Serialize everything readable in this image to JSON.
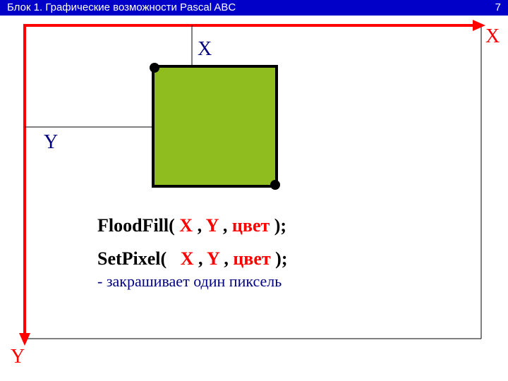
{
  "header": {
    "title": "Блок 1.  Графические возможности Pascal ABC",
    "page": "7"
  },
  "axes": {
    "x": "X",
    "y": "Y"
  },
  "coord": {
    "x": "X",
    "y": "Y"
  },
  "code": {
    "floodfill": {
      "fn": "FloodFill(",
      "x": "X",
      "c1": " , ",
      "y": "Y",
      "c2": " , ",
      "color": " цвет",
      "end": " );"
    },
    "setpixel": {
      "fn": "SetPixel(",
      "x": "X",
      "c1": " , ",
      "y": "Y",
      "c2": " , ",
      "color": "цвет",
      "end": " );"
    },
    "desc": "- закрашивает один пиксель"
  },
  "colors": {
    "red": "#ff0000",
    "blue": "#000080",
    "fill": "#8fbc1f",
    "black": "#000000"
  }
}
